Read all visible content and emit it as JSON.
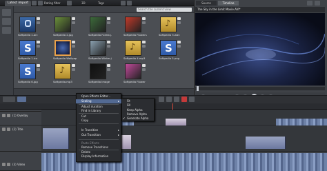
{
  "topbar": {
    "tab_latest_import": "Latest import",
    "rating_filter": "Rating filter",
    "view_3d": "3D",
    "tags": "Tags",
    "search_placeholder": "Search the current view"
  },
  "library": {
    "items": [
      {
        "label": "Softpedia 1.arc",
        "kind": "lock",
        "color": "#2c4a7a"
      },
      {
        "label": "Softpedia 2.jpg",
        "kind": "photo",
        "color": "#6a8f3a"
      },
      {
        "label": "Softpedia Forest.j...",
        "kind": "photo",
        "color": "#3c6a3a"
      },
      {
        "label": "Softpedia Flowers.jpg",
        "kind": "photo",
        "color": "#c23a2a"
      },
      {
        "label": "Softpedia 3.wav",
        "kind": "music",
        "color": "#c9a23a"
      },
      {
        "label": "Softpedia 1.ico",
        "kind": "s",
        "color": "#2e5aa8"
      },
      {
        "label": "Softpedia Wallpap...",
        "kind": "photo-selected",
        "color": "#1c2a5a"
      },
      {
        "label": "Softpedia Winter.j...",
        "kind": "photo",
        "color": "#8aa0b0"
      },
      {
        "label": "Softpedia 4.mp3",
        "kind": "music",
        "color": "#c9a23a"
      },
      {
        "label": "Softpedia 5.png",
        "kind": "s",
        "color": "#2e5aa8"
      },
      {
        "label": "Softpedia 6.jpg",
        "kind": "s",
        "color": "#2e5aa8"
      },
      {
        "label": "Softpedia.mp3",
        "kind": "music",
        "color": "#c9a23a"
      },
      {
        "label": "Softpedia Image",
        "kind": "photo",
        "color": "#101010"
      },
      {
        "label": "Softpedia Flower",
        "kind": "photo",
        "color": "#c04a9a"
      }
    ]
  },
  "player": {
    "tab_source": "Source",
    "tab_timeline": "Timeline",
    "title": "The Sky in the Limit Movie.AVI*",
    "counter": "00:00:00.00"
  },
  "timeline": {
    "tracks": [
      {
        "name": "(1) Overlay"
      },
      {
        "name": "(2) Title"
      },
      {
        "name": "(3) Video"
      }
    ]
  },
  "context_menu": {
    "items": [
      {
        "label": "Open Effects Editor...",
        "state": "normal"
      },
      {
        "label": "Scaling",
        "state": "selected"
      },
      {
        "label": "Adjust duration",
        "state": "normal"
      },
      {
        "label": "Find in Library",
        "state": "normal"
      },
      {
        "label": "Cut",
        "state": "normal"
      },
      {
        "label": "Copy",
        "state": "normal"
      },
      {
        "label": "In Transition",
        "state": "normal"
      },
      {
        "label": "Out Transition",
        "state": "normal"
      },
      {
        "label": "Paste Effects",
        "state": "disabled"
      },
      {
        "label": "Remove Transitions",
        "state": "normal"
      },
      {
        "label": "Delete",
        "state": "normal"
      },
      {
        "label": "Display Information",
        "state": "normal"
      }
    ]
  },
  "scaling_submenu": {
    "items": [
      {
        "label": "Fit",
        "checked": false
      },
      {
        "label": "Fill",
        "checked": false
      },
      {
        "label": "Keep Alpha",
        "checked": false
      },
      {
        "label": "Remove Alpha",
        "checked": false
      },
      {
        "label": "Generate Alpha",
        "checked": true
      }
    ]
  }
}
